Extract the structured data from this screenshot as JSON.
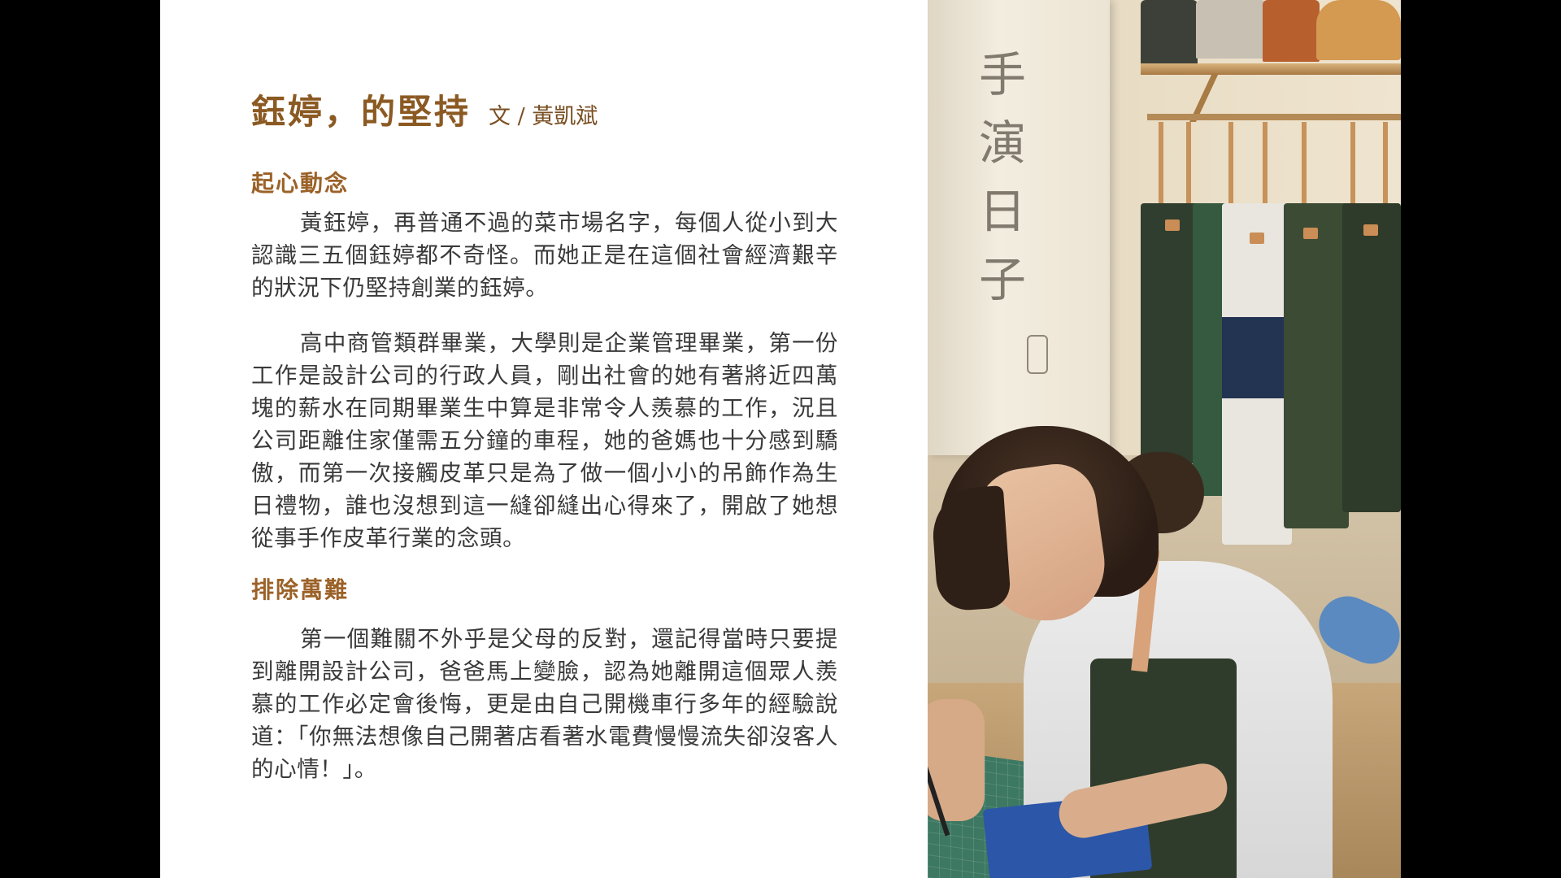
{
  "article": {
    "title": "鈺婷，的堅持",
    "byline": "文 / 黃凱斌",
    "sections": [
      {
        "heading": "起心動念",
        "paragraphs": [
          "黃鈺婷，再普通不過的菜市場名字，每個人從小到大認識三五個鈺婷都不奇怪。而她正是在這個社會經濟艱辛的狀況下仍堅持創業的鈺婷。",
          "高中商管類群畢業，大學則是企業管理畢業，第一份工作是設計公司的行政人員，剛出社會的她有著將近四萬塊的薪水在同期畢業生中算是非常令人羨慕的工作，況且公司距離住家僅需五分鐘的車程，她的爸媽也十分感到驕傲，而第一次接觸皮革只是為了做一個小小的吊飾作為生日禮物，誰也沒想到這一縫卻縫出心得來了，開啟了她想從事手作皮革行業的念頭。"
        ]
      },
      {
        "heading": "排除萬難",
        "paragraphs": [
          "第一個難關不外乎是父母的反對，還記得當時只要提到離開設計公司，爸爸馬上變臉，認為她離開這個眾人羨慕的工作必定會後悔，更是由自己開機車行多年的經驗說道：「你無法想像自己開著店看著水電費慢慢流失卻沒客人的心情！」。"
        ]
      }
    ]
  },
  "photo": {
    "banner_text": "手演日子",
    "description_icon": "craft-photo"
  },
  "colors": {
    "title": "#8b5a23",
    "heading": "#9b6228",
    "body": "#3a3a3a",
    "background": "#ffffff",
    "letterbox": "#000000"
  }
}
